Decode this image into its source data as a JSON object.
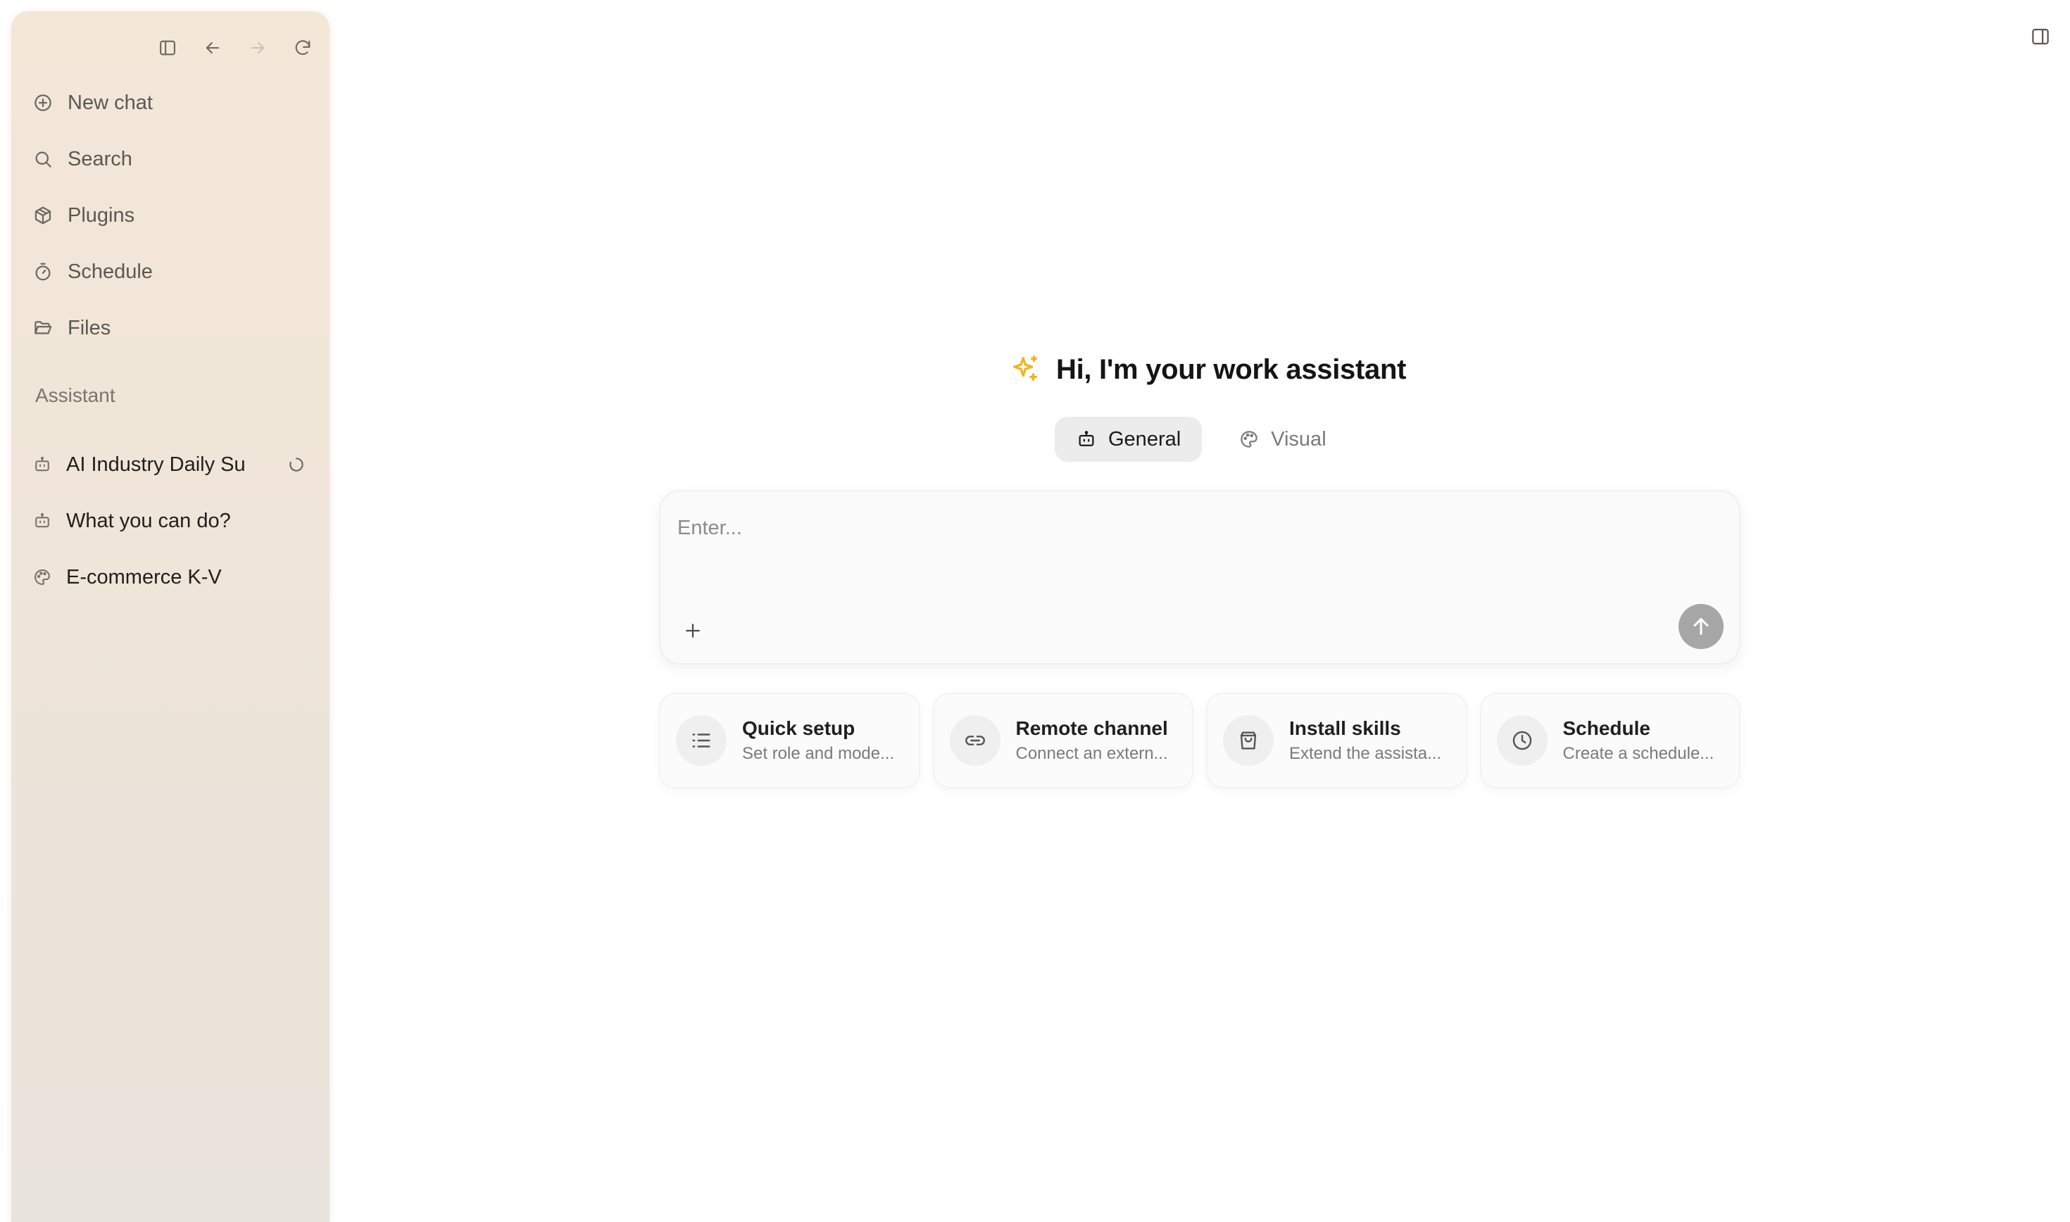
{
  "sidebar": {
    "toolbar": {
      "toggle_icon": "sidebar-toggle-icon",
      "back_icon": "arrow-left-icon",
      "forward_icon": "arrow-right-icon",
      "refresh_icon": "refresh-icon"
    },
    "nav": [
      {
        "label": "New chat",
        "icon": "plus-circle-icon"
      },
      {
        "label": "Search",
        "icon": "search-icon"
      },
      {
        "label": "Plugins",
        "icon": "package-icon"
      },
      {
        "label": "Schedule",
        "icon": "timer-icon"
      },
      {
        "label": "Files",
        "icon": "folder-open-icon"
      }
    ],
    "section_label": "Assistant",
    "assistants": [
      {
        "label": "AI Industry Daily Su",
        "icon": "bot-icon",
        "status": "loading"
      },
      {
        "label": "What you can do?",
        "icon": "bot-icon"
      },
      {
        "label": "E-commerce K-V",
        "icon": "palette-icon"
      }
    ]
  },
  "header": {
    "panel_toggle_icon": "panel-right-icon"
  },
  "main": {
    "greeting_icon": "sparkles-icon",
    "greeting": "Hi, I'm your work assistant",
    "modes": [
      {
        "label": "General",
        "icon": "bot-icon",
        "active": true
      },
      {
        "label": "Visual",
        "icon": "palette-icon",
        "active": false
      }
    ],
    "composer": {
      "placeholder": "Enter...",
      "value": ""
    },
    "cards": [
      {
        "title": "Quick setup",
        "subtitle": "Set role and mode...",
        "icon": "list-icon"
      },
      {
        "title": "Remote channel",
        "subtitle": "Connect an extern...",
        "icon": "link-icon"
      },
      {
        "title": "Install skills",
        "subtitle": "Extend the assista...",
        "icon": "shopping-bag-icon"
      },
      {
        "title": "Schedule",
        "subtitle": "Create a schedule...",
        "icon": "clock-icon"
      }
    ]
  },
  "colors": {
    "accent_sparkle": "#f2b416",
    "send_button": "#a6a6a6",
    "sidebar_top": "#f3e7d8",
    "sidebar_bottom": "#e8e3dc"
  }
}
